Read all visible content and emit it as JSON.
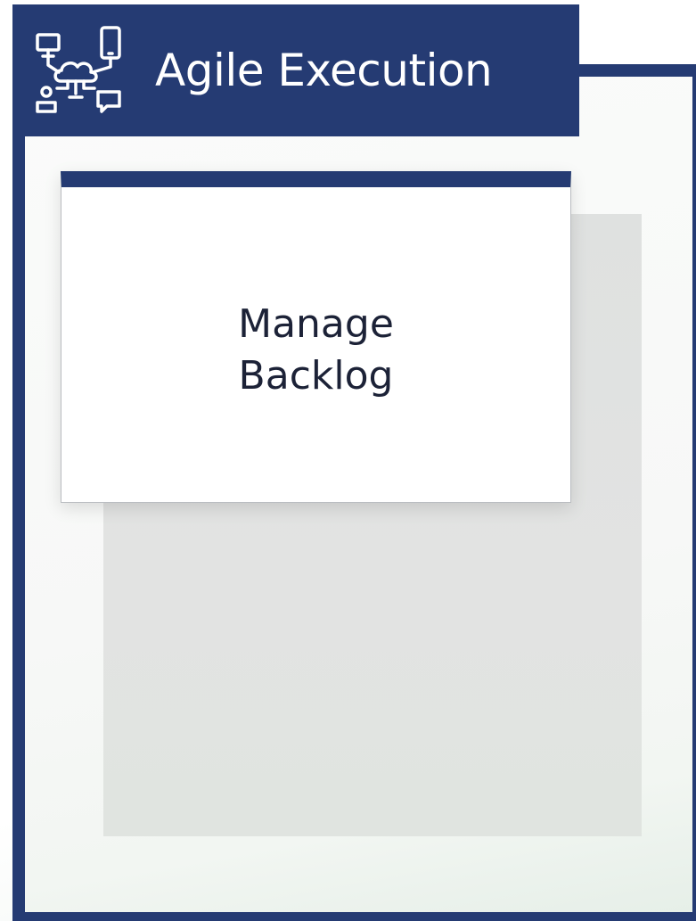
{
  "header": {
    "title": "Agile Execution",
    "icon": "network-cloud-devices-icon"
  },
  "card": {
    "line1": "Manage",
    "line2": "Backlog"
  },
  "colors": {
    "navy": "#253b73",
    "card_bg": "#ffffff",
    "panel_gray": "#e0e2e1",
    "text_dark": "#1c2237"
  }
}
